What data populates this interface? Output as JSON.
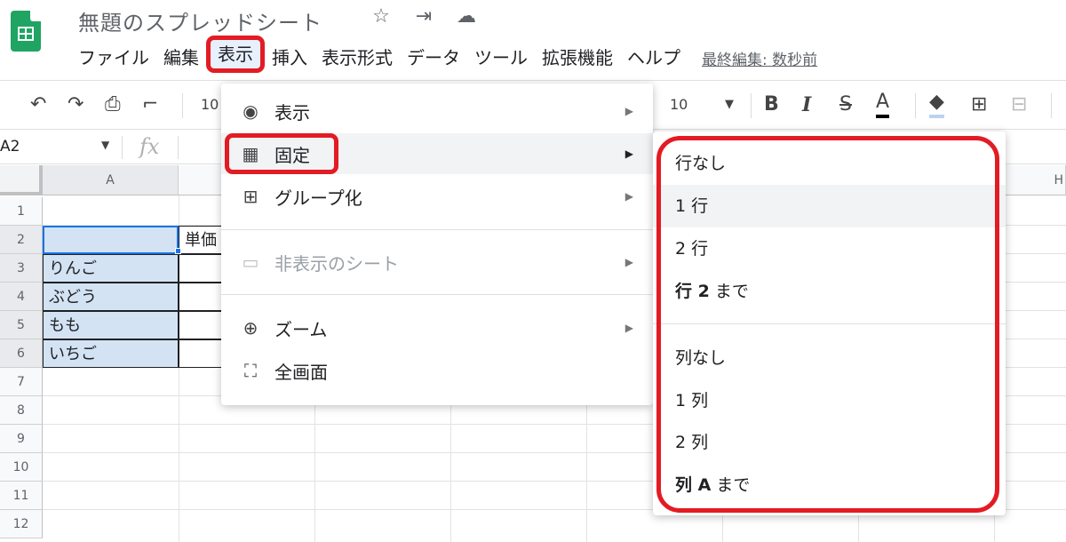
{
  "app": {
    "title": "無題のスプレッドシート",
    "brand_color": "#1fa463"
  },
  "title_icons": [
    "☆",
    "⇥",
    "☁"
  ],
  "menubar": {
    "items": [
      "ファイル",
      "編集",
      "表示",
      "挿入",
      "表示形式",
      "データ",
      "ツール",
      "拡張機能",
      "ヘルプ"
    ],
    "active": "表示",
    "last_edit": "最終編集: 数秒前"
  },
  "toolbar": {
    "zoom_partial": "10",
    "font_size": "10",
    "bold": "B",
    "italic": "I",
    "strike": "S",
    "text_color": "A"
  },
  "formula_bar": {
    "name_box": "A2",
    "fx": "fx"
  },
  "grid": {
    "columns": [
      "A",
      "",
      "",
      "",
      "",
      "",
      "",
      "H"
    ],
    "rows": [
      "1",
      "2",
      "3",
      "4",
      "5",
      "6",
      "7",
      "8",
      "9",
      "10",
      "11",
      "12"
    ],
    "cells": {
      "b2": "単価",
      "a3": "りんご",
      "a4": "ぶどう",
      "a5": "もも",
      "a6": "いちご"
    }
  },
  "view_menu": {
    "items": [
      {
        "label": "表示",
        "icon": "eye-icon",
        "glyph": "◉",
        "submenu": true
      },
      {
        "label": "固定",
        "icon": "freeze-icon",
        "glyph": "▦",
        "submenu": true,
        "highlighted": true
      },
      {
        "label": "グループ化",
        "icon": "group-icon",
        "glyph": "⊞",
        "submenu": true
      },
      {
        "label": "非表示のシート",
        "icon": "hidden-sheet-icon",
        "glyph": "▭",
        "submenu": true,
        "disabled": true
      },
      {
        "label": "ズーム",
        "icon": "zoom-icon",
        "glyph": "⊕",
        "submenu": true
      },
      {
        "label": "全画面",
        "icon": "fullscreen-icon",
        "glyph": "⛶",
        "submenu": false
      }
    ]
  },
  "freeze_submenu": {
    "rows": [
      "行なし",
      "1 行",
      "2 行"
    ],
    "rows_upto_bold": "行 2",
    "rows_upto_suffix": " まで",
    "cols": [
      "列なし",
      "1 列",
      "2 列"
    ],
    "cols_upto_bold": "列 A",
    "cols_upto_suffix": " まで"
  },
  "annotation_color": "#e31b23",
  "selection_color": "#d3e3f4"
}
